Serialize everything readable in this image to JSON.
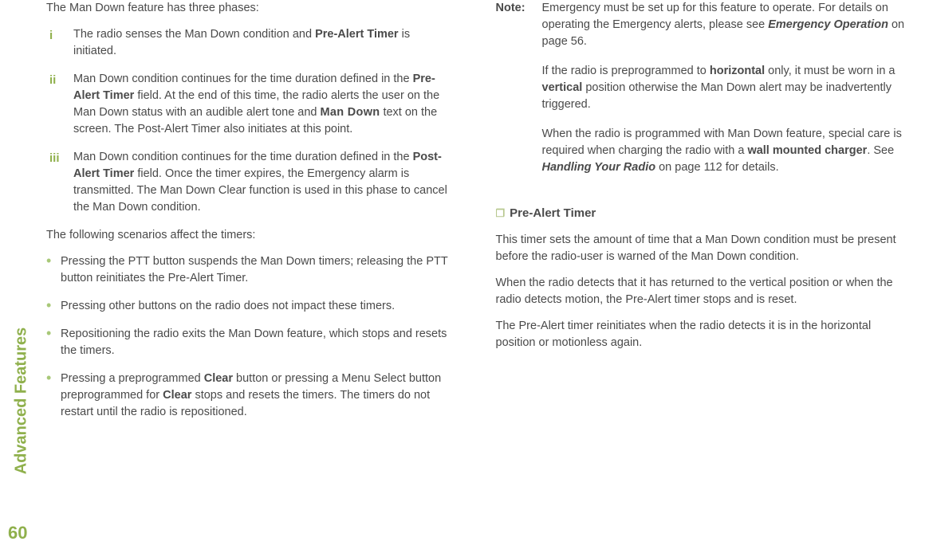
{
  "sidebar": {
    "label": "Advanced Features"
  },
  "pageNumber": "60",
  "left": {
    "phasesIntro": "The Man Down feature has three phases:",
    "phases": [
      {
        "num": "i",
        "pre": "The radio senses the Man Down condition and ",
        "b1": "Pre-Alert Timer",
        "post": " is initiated."
      },
      {
        "num": "ii",
        "pre": "Man Down condition continues for the time duration defined in the ",
        "b1": "Pre-Alert Timer",
        "mid": " field. At the end of this time, the radio alerts the user on the Man Down status with an audible alert tone and ",
        "disp": "Man Down",
        "post": " text on the screen. The Post-Alert Timer also initiates at this point."
      },
      {
        "num": "iii",
        "pre": "Man Down condition continues for the time duration defined in the ",
        "b1": "Post-Alert Timer",
        "post": " field. Once the timer expires, the Emergency alarm is transmitted. The Man Down Clear function is used in this phase to cancel the Man Down condition."
      }
    ],
    "scenariosIntro": "The following scenarios affect the timers:",
    "bullets": [
      {
        "text": "Pressing the PTT button suspends the Man Down timers; releasing the PTT button reinitiates the Pre-Alert Timer."
      },
      {
        "text": "Pressing other buttons on the radio does not impact these timers."
      },
      {
        "text": "Repositioning the radio exits the Man Down feature, which stops and resets the timers."
      },
      {
        "pre": "Pressing a preprogrammed ",
        "b1": "Clear",
        "mid": " button or pressing a Menu Select button preprogrammed for ",
        "b2": "Clear",
        "post": " stops and resets the timers. The timers do not restart until the radio is repositioned."
      }
    ]
  },
  "right": {
    "noteLabel": "Note:",
    "note": {
      "p1pre": "Emergency must be set up for this feature to operate. For details on operating the Emergency alerts, please see ",
      "p1bi": "Emergency Operation",
      "p1post": " on page 56.",
      "p2pre": "If the radio is preprogrammed to ",
      "p2b1": "horizontal",
      "p2mid": " only, it must be worn in a ",
      "p2b2": "vertical",
      "p2post": " position otherwise the Man Down alert may be inadvertently triggered.",
      "p3pre": "When the radio is programmed with Man Down feature, special care is required when charging the radio with a ",
      "p3b1": "wall mounted charger",
      "p3mid": ". See ",
      "p3bi": "Handling Your Radio",
      "p3post": " on page 112 for details."
    },
    "subheading": "Pre-Alert Timer",
    "paras": [
      "This timer sets the amount of time that a Man Down condition must be present before the radio-user is warned of the Man Down condition.",
      "When the radio detects that it has returned to the vertical position or when the radio detects motion, the Pre-Alert timer stops and is reset.",
      "The Pre-Alert timer reinitiates when the radio detects it is in the horizontal position or motionless again."
    ]
  }
}
